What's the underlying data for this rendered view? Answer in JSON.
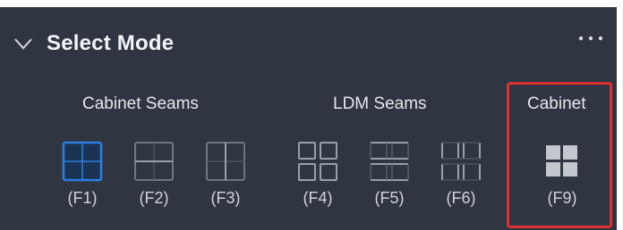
{
  "panel": {
    "title": "Select Mode",
    "more_label": "···"
  },
  "groups": [
    {
      "label": "Cabinet Seams"
    },
    {
      "label": "LDM Seams"
    },
    {
      "label": "Cabinet"
    }
  ],
  "buttons": [
    {
      "key": "(F1)",
      "icon": "cabinet-seams-all-icon",
      "selected": true
    },
    {
      "key": "(F2)",
      "icon": "cabinet-seams-horizontal-icon",
      "selected": false
    },
    {
      "key": "(F3)",
      "icon": "cabinet-seams-vertical-icon",
      "selected": false
    },
    {
      "key": "(F4)",
      "icon": "ldm-seams-all-icon",
      "selected": false
    },
    {
      "key": "(F5)",
      "icon": "ldm-seams-horizontal-icon",
      "selected": false
    },
    {
      "key": "(F6)",
      "icon": "ldm-seams-vertical-icon",
      "selected": false
    },
    {
      "key": "(F9)",
      "icon": "cabinet-grid-icon",
      "selected": false
    }
  ],
  "colors": {
    "panel_bg": "#2f3642",
    "selected_accent": "#2a7fe0",
    "icon_gray": "#8d939c",
    "highlight_red": "#e03030"
  }
}
